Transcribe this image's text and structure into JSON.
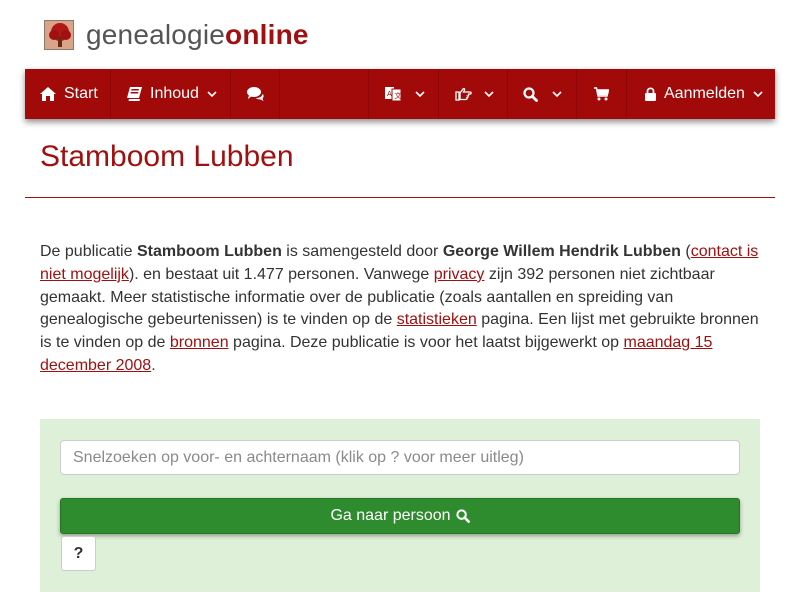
{
  "brand": {
    "part1": "genealogie",
    "part2": "online",
    "logo_icon": "tree-logo-icon"
  },
  "nav": {
    "start_label": "Start",
    "inhoud_label": "Inhoud",
    "aanmelden_label": "Aanmelden",
    "icons": [
      "home-icon",
      "book-icon",
      "chat-icon",
      "language-icon",
      "hand-point-icon",
      "search-icon",
      "cart-icon",
      "lock-icon"
    ]
  },
  "page": {
    "title": "Stamboom Lubben"
  },
  "intro": {
    "t1": "De publicatie ",
    "pub_name": "Stamboom Lubben",
    "t2": " is samengesteld door ",
    "author": "George Willem Hendrik Lubben",
    "t3": " (",
    "contact_link": "contact is niet mogelijk",
    "t4": "). en bestaat uit 1.477 personen. Vanwege ",
    "privacy_link": "privacy",
    "t5": " zijn 392 personen niet zichtbaar gemaakt. Meer statistische informatie over de publicatie (zoals aantallen en spreiding van genealogische gebeurtenissen) is te vinden op de ",
    "stats_link": "statistieken",
    "t6": " pagina. Een lijst met gebruikte bronnen is te vinden op de ",
    "sources_link": "bronnen",
    "t7": " pagina. Deze publicatie is voor het laatst bijgewerkt op ",
    "date_link": "maandag 15 december 2008",
    "t8": "."
  },
  "search": {
    "placeholder": "Snelzoeken op voor- en achternaam (klik op ? voor meer uitleg)",
    "value": "",
    "go_label": "Ga naar persoon",
    "help_label": "?"
  },
  "colors": {
    "brand": "#a20a0a",
    "panel": "#dff0d8",
    "button": "#2e8b2e"
  }
}
